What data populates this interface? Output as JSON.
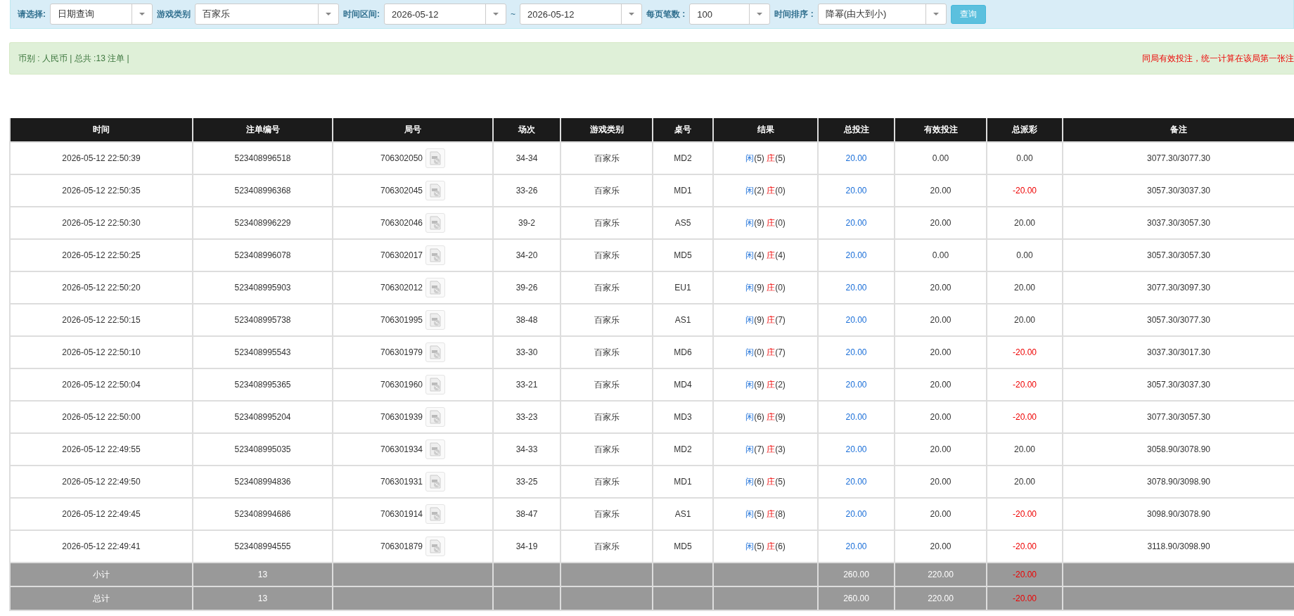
{
  "filters": [
    {
      "label": "请选择:",
      "value": "日期查询"
    },
    {
      "label": "游戏类别",
      "value": "百家乐"
    },
    {
      "label": "时间区间:",
      "value": "2026-05-12",
      "separator": "~",
      "value_end": "2026-05-12"
    },
    {
      "label": "每页笔数 :",
      "value": "100"
    },
    {
      "label": "时间排序 :",
      "value": "降幂(由大到小)"
    }
  ],
  "query_button": "查询",
  "summary": "币别 : 人民币 | 总共 :13 注单 |",
  "notice": "同局有效投注，统一计算在该局第一张注",
  "table": {
    "columns": [
      "时间",
      "注单编号",
      "局号",
      "场次",
      "游戏类别",
      "桌号",
      "结果",
      "总投注",
      "有效投注",
      "总派彩",
      "备注"
    ],
    "rows": [
      {
        "time": "2026-05-12 22:50:39",
        "bet_id": "523408996518",
        "round": "706302050",
        "game_no": "34-34",
        "game": "百家乐",
        "table": "MD2",
        "player_label": "闲",
        "player": "(5)",
        "banker_label": "庄",
        "banker": "(5)",
        "bet": "20.00",
        "valid_bet": "0.00",
        "payout": "0.00",
        "payout_negative": false,
        "remark": "3077.30/3077.30"
      },
      {
        "time": "2026-05-12 22:50:35",
        "bet_id": "523408996368",
        "round": "706302045",
        "game_no": "33-26",
        "game": "百家乐",
        "table": "MD1",
        "player_label": "闲",
        "player": "(2)",
        "banker_label": "庄",
        "banker": "(0)",
        "bet": "20.00",
        "valid_bet": "20.00",
        "payout": "-20.00",
        "payout_negative": true,
        "remark": "3057.30/3037.30"
      },
      {
        "time": "2026-05-12 22:50:30",
        "bet_id": "523408996229",
        "round": "706302046",
        "game_no": "39-2",
        "game": "百家乐",
        "table": "AS5",
        "player_label": "闲",
        "player": "(9)",
        "banker_label": "庄",
        "banker": "(0)",
        "bet": "20.00",
        "valid_bet": "20.00",
        "payout": "20.00",
        "payout_negative": false,
        "remark": "3037.30/3057.30"
      },
      {
        "time": "2026-05-12 22:50:25",
        "bet_id": "523408996078",
        "round": "706302017",
        "game_no": "34-20",
        "game": "百家乐",
        "table": "MD5",
        "player_label": "闲",
        "player": "(4)",
        "banker_label": "庄",
        "banker": "(4)",
        "bet": "20.00",
        "valid_bet": "0.00",
        "payout": "0.00",
        "payout_negative": false,
        "remark": "3057.30/3057.30"
      },
      {
        "time": "2026-05-12 22:50:20",
        "bet_id": "523408995903",
        "round": "706302012",
        "game_no": "39-26",
        "game": "百家乐",
        "table": "EU1",
        "player_label": "闲",
        "player": "(9)",
        "banker_label": "庄",
        "banker": "(0)",
        "bet": "20.00",
        "valid_bet": "20.00",
        "payout": "20.00",
        "payout_negative": false,
        "remark": "3077.30/3097.30"
      },
      {
        "time": "2026-05-12 22:50:15",
        "bet_id": "523408995738",
        "round": "706301995",
        "game_no": "38-48",
        "game": "百家乐",
        "table": "AS1",
        "player_label": "闲",
        "player": "(9)",
        "banker_label": "庄",
        "banker": "(7)",
        "bet": "20.00",
        "valid_bet": "20.00",
        "payout": "20.00",
        "payout_negative": false,
        "remark": "3057.30/3077.30"
      },
      {
        "time": "2026-05-12 22:50:10",
        "bet_id": "523408995543",
        "round": "706301979",
        "game_no": "33-30",
        "game": "百家乐",
        "table": "MD6",
        "player_label": "闲",
        "player": "(0)",
        "banker_label": "庄",
        "banker": "(7)",
        "bet": "20.00",
        "valid_bet": "20.00",
        "payout": "-20.00",
        "payout_negative": true,
        "remark": "3037.30/3017.30"
      },
      {
        "time": "2026-05-12 22:50:04",
        "bet_id": "523408995365",
        "round": "706301960",
        "game_no": "33-21",
        "game": "百家乐",
        "table": "MD4",
        "player_label": "闲",
        "player": "(9)",
        "banker_label": "庄",
        "banker": "(2)",
        "bet": "20.00",
        "valid_bet": "20.00",
        "payout": "-20.00",
        "payout_negative": true,
        "remark": "3057.30/3037.30"
      },
      {
        "time": "2026-05-12 22:50:00",
        "bet_id": "523408995204",
        "round": "706301939",
        "game_no": "33-23",
        "game": "百家乐",
        "table": "MD3",
        "player_label": "闲",
        "player": "(6)",
        "banker_label": "庄",
        "banker": "(9)",
        "bet": "20.00",
        "valid_bet": "20.00",
        "payout": "-20.00",
        "payout_negative": true,
        "remark": "3077.30/3057.30"
      },
      {
        "time": "2026-05-12 22:49:55",
        "bet_id": "523408995035",
        "round": "706301934",
        "game_no": "34-33",
        "game": "百家乐",
        "table": "MD2",
        "player_label": "闲",
        "player": "(7)",
        "banker_label": "庄",
        "banker": "(3)",
        "bet": "20.00",
        "valid_bet": "20.00",
        "payout": "20.00",
        "payout_negative": false,
        "remark": "3058.90/3078.90"
      },
      {
        "time": "2026-05-12 22:49:50",
        "bet_id": "523408994836",
        "round": "706301931",
        "game_no": "33-25",
        "game": "百家乐",
        "table": "MD1",
        "player_label": "闲",
        "player": "(6)",
        "banker_label": "庄",
        "banker": "(5)",
        "bet": "20.00",
        "valid_bet": "20.00",
        "payout": "20.00",
        "payout_negative": false,
        "remark": "3078.90/3098.90"
      },
      {
        "time": "2026-05-12 22:49:45",
        "bet_id": "523408994686",
        "round": "706301914",
        "game_no": "38-47",
        "game": "百家乐",
        "table": "AS1",
        "player_label": "闲",
        "player": "(5)",
        "banker_label": "庄",
        "banker": "(8)",
        "bet": "20.00",
        "valid_bet": "20.00",
        "payout": "-20.00",
        "payout_negative": true,
        "remark": "3098.90/3078.90"
      },
      {
        "time": "2026-05-12 22:49:41",
        "bet_id": "523408994555",
        "round": "706301879",
        "game_no": "34-19",
        "game": "百家乐",
        "table": "MD5",
        "player_label": "闲",
        "player": "(5)",
        "banker_label": "庄",
        "banker": "(6)",
        "bet": "20.00",
        "valid_bet": "20.00",
        "payout": "-20.00",
        "payout_negative": true,
        "remark": "3118.90/3098.90"
      }
    ],
    "totals": [
      {
        "label": "小计",
        "count": "13",
        "bet": "260.00",
        "valid_bet": "220.00",
        "payout": "-20.00",
        "payout_negative": true
      },
      {
        "label": "总计",
        "count": "13",
        "bet": "260.00",
        "valid_bet": "220.00",
        "payout": "-20.00",
        "payout_negative": true
      }
    ]
  }
}
